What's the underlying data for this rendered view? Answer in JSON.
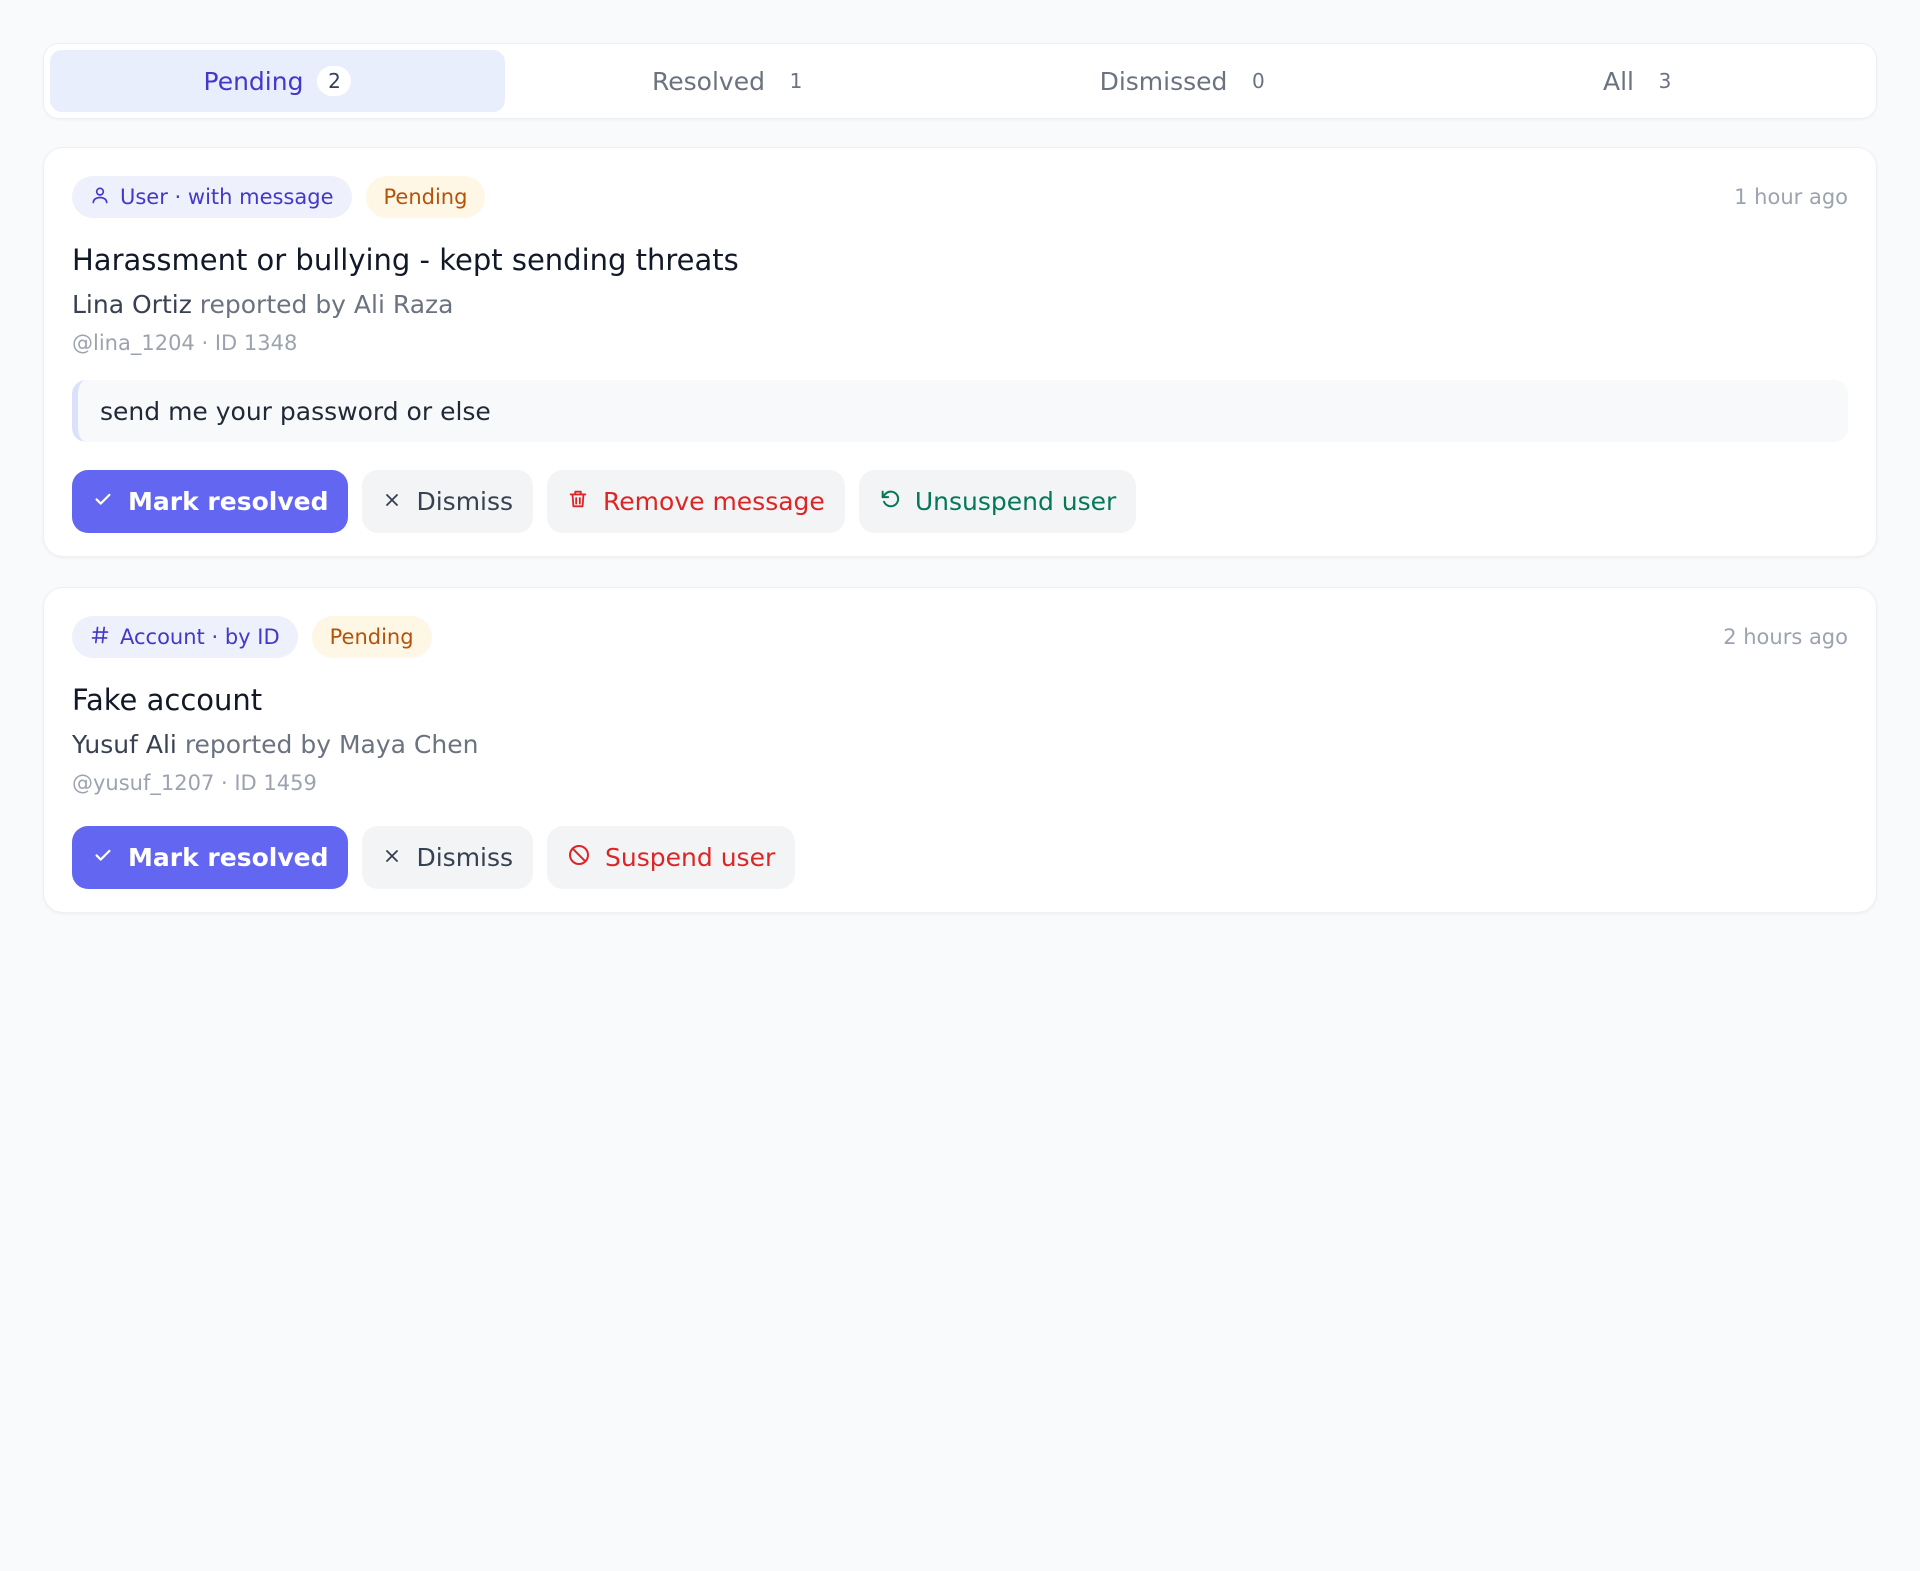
{
  "tabs": [
    {
      "label": "Pending",
      "count": "2",
      "active": true
    },
    {
      "label": "Resolved",
      "count": "1"
    },
    {
      "label": "Dismissed",
      "count": "0"
    },
    {
      "label": "All",
      "count": "3"
    }
  ],
  "reports": [
    {
      "kind_label": "User · with message",
      "kind_icon": "user-icon",
      "status": "Pending",
      "time": "1 hour ago",
      "title": "Harassment or bullying - kept sending threats",
      "subject_name": "Lina Ortiz",
      "reported_by": "reported by Ali Raza",
      "meta": "@lina_1204 · ID 1348",
      "message": "send me your password or else",
      "actions": {
        "resolve": "Mark resolved",
        "dismiss": "Dismiss",
        "remove": "Remove message",
        "unsuspend": "Unsuspend user"
      }
    },
    {
      "kind_label": "Account · by ID",
      "kind_icon": "hash-icon",
      "status": "Pending",
      "time": "2 hours ago",
      "title": "Fake account",
      "subject_name": "Yusuf Ali",
      "reported_by": "reported by Maya Chen",
      "meta": "@yusuf_1207 · ID 1459",
      "actions": {
        "resolve": "Mark resolved",
        "dismiss": "Dismiss",
        "suspend": "Suspend user"
      }
    }
  ],
  "colors": {
    "accent": "#6366f1",
    "danger": "#dc2626",
    "success": "#047857",
    "pending": "#b45309"
  }
}
